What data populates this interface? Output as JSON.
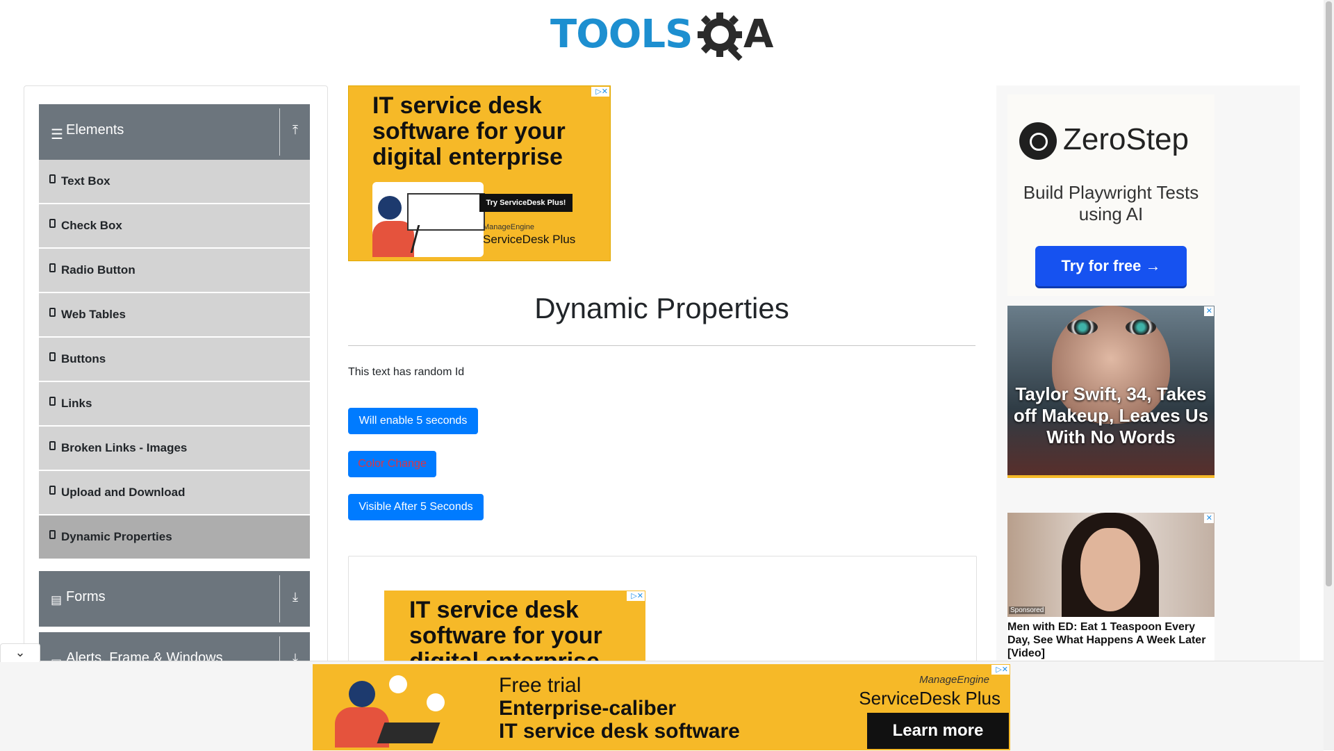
{
  "header": {
    "logo_tools": "TOOLS",
    "logo_qa": "QA"
  },
  "sidebar": {
    "groups": [
      {
        "title": "Elements",
        "icon": "hamburger-icon",
        "arrow": "upload-icon",
        "expanded": true
      },
      {
        "title": "Forms",
        "icon": "document-icon",
        "arrow": "download-icon"
      },
      {
        "title": "Alerts, Frame & Windows",
        "icon": "window-icon",
        "arrow": "download-icon"
      }
    ],
    "items": [
      {
        "label": "Text Box"
      },
      {
        "label": "Check Box"
      },
      {
        "label": "Radio Button"
      },
      {
        "label": "Web Tables"
      },
      {
        "label": "Buttons"
      },
      {
        "label": "Links"
      },
      {
        "label": "Broken Links - Images"
      },
      {
        "label": "Upload and Download"
      },
      {
        "label": "Dynamic Properties",
        "active": true
      }
    ]
  },
  "main": {
    "title": "Dynamic Properties",
    "random_text": "This text has random Id",
    "buttons": {
      "enable": "Will enable 5 seconds",
      "color_change": "Color Change",
      "visible_after": "Visible After 5 Seconds"
    }
  },
  "ads": {
    "top_ad": {
      "headline": "IT service desk software for your digital enterprise",
      "cta": "Try ServiceDesk Plus!",
      "brand_small": "ManageEngine",
      "brand": "ServiceDesk Plus"
    },
    "inner_ad": {
      "headline": "IT service desk software for your digital enterprise"
    },
    "zerostep": {
      "brand": "ZeroStep",
      "tagline": "Build Playwright Tests using AI",
      "cta": "Try for free →"
    },
    "celebrity": {
      "caption": "Taylor Swift, 34, Takes off Makeup, Leaves Us With No Words"
    },
    "sponsored": {
      "badge": "Sponsored",
      "title": "Men with ED: Eat 1 Teaspoon Every Day, See What Happens A Week Later [Video]"
    },
    "bottom_ad": {
      "line1": "Free trial",
      "line2": "Enterprise-caliber",
      "line3": "IT service desk software",
      "brand_small": "ManageEngine",
      "brand": "ServiceDesk Plus",
      "cta": "Learn more"
    }
  },
  "colors": {
    "primary_button": "#007bff",
    "menu_header": "#6c757d",
    "menu_item": "#d3d3d3",
    "ad_yellow": "#f6b928",
    "logo_blue": "#1d8fd0"
  }
}
